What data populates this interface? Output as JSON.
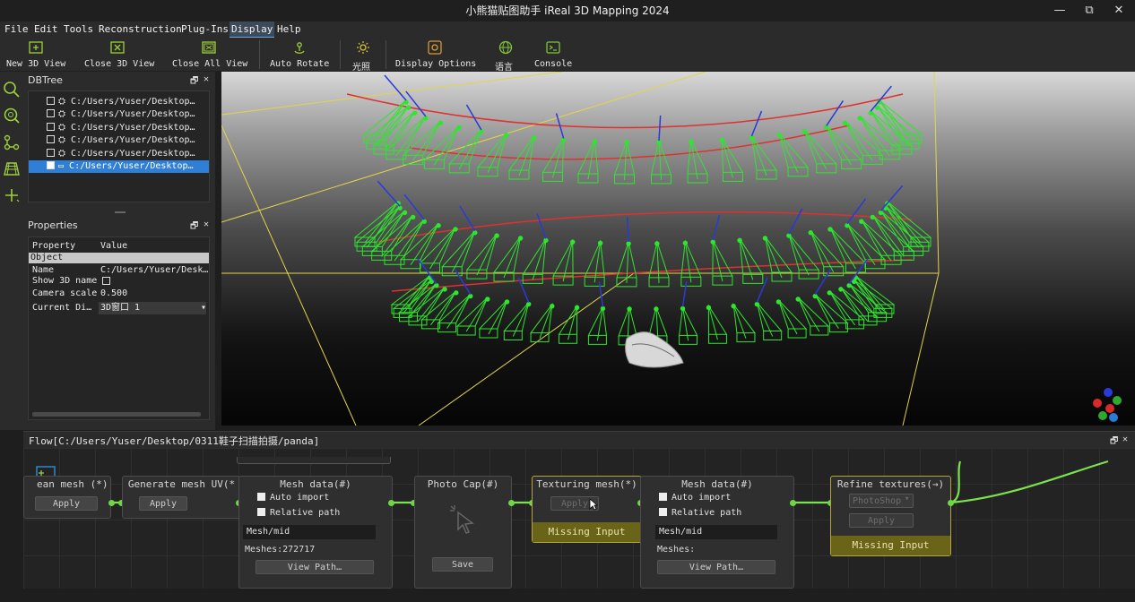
{
  "window": {
    "title": "小熊猫贴图助手 iReal 3D Mapping 2024",
    "minimize": "—",
    "restore": "⧉",
    "close": "✕"
  },
  "menubar": [
    "File",
    "Edit",
    "Tools",
    "Reconstruction",
    "Plug-Ins",
    "Display",
    "Help"
  ],
  "menubar_active": "Display",
  "toolbar": {
    "new_3d_view": "New 3D View",
    "close_3d_view": "Close 3D View",
    "close_all_view": "Close All View",
    "auto_rotate": "Auto Rotate",
    "light": "光照",
    "display_options": "Display Options",
    "language": "语言",
    "console": "Console"
  },
  "dbtree": {
    "title": "DBTree",
    "float": "🗗",
    "close": "✕",
    "items": [
      {
        "label": "C:/Users/Yuser/Desktop…",
        "checked": false,
        "selected": false
      },
      {
        "label": "C:/Users/Yuser/Desktop…",
        "checked": false,
        "selected": false
      },
      {
        "label": "C:/Users/Yuser/Desktop…",
        "checked": false,
        "selected": false
      },
      {
        "label": "C:/Users/Yuser/Desktop…",
        "checked": false,
        "selected": false
      },
      {
        "label": "C:/Users/Yuser/Desktop…",
        "checked": false,
        "selected": false
      },
      {
        "label": "C:/Users/Yuser/Desktop…",
        "checked": true,
        "selected": true
      }
    ]
  },
  "properties": {
    "title": "Properties",
    "header_property": "Property",
    "header_value": "Value",
    "section": "Object",
    "rows": [
      {
        "key": "Name",
        "value": "C:/Users/Yuser/Desk…"
      },
      {
        "key": "Show 3D name",
        "value": ""
      },
      {
        "key": "Camera scale",
        "value": "0.500"
      },
      {
        "key": "Current Di…",
        "value": "3D窗口 1"
      }
    ]
  },
  "flow": {
    "title": "Flow[C:/Users/Yuser/Desktop/0311鞋子扫描拍摄/panda]",
    "nodes": {
      "clean_mesh": {
        "title": "ean mesh (*)",
        "apply": "Apply"
      },
      "generate_uv": {
        "title": "Generate mesh UV(*",
        "apply": "Apply"
      },
      "mesh_data_1": {
        "title": "Mesh data(#)",
        "auto_import": "Auto import",
        "relative_path": "Relative path",
        "path": "Mesh/mid",
        "meshes": "Meshes:272717",
        "view_path": "View Path…"
      },
      "photo_cap": {
        "title": "Photo Cap(#)",
        "save": "Save"
      },
      "texturing": {
        "title": "Texturing mesh(*)",
        "apply": "Apply",
        "missing": "Missing Input"
      },
      "mesh_data_2": {
        "title": "Mesh data(#)",
        "auto_import": "Auto import",
        "relative_path": "Relative path",
        "path": "Mesh/mid",
        "meshes": "Meshes:",
        "view_path": "View Path…"
      },
      "refine": {
        "title": "Refine textures(→)",
        "select": "PhotoShop",
        "apply": "Apply",
        "missing": "Missing Input"
      }
    }
  },
  "colors": {
    "accent": "#2f7fd6",
    "camera_frustum": "#2ee62e",
    "warning": "#6a6418",
    "link": "#7be24f"
  }
}
